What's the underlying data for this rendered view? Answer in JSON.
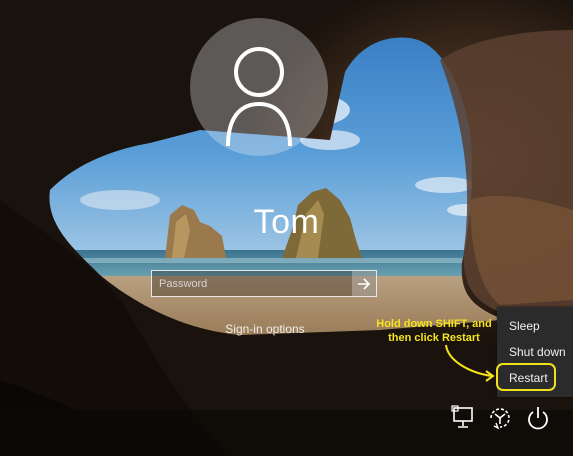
{
  "user": {
    "name": "Tom"
  },
  "password": {
    "placeholder": "Password"
  },
  "signin_options_label": "Sign-in options",
  "power_menu": {
    "items": [
      "Sleep",
      "Shut down",
      "Restart"
    ]
  },
  "annotation": {
    "text": "Hold down SHIFT, and then click Restart",
    "color": "#f5e41c"
  },
  "icons": {
    "submit": "arrow-right-icon",
    "network": "network-icon",
    "ease_of_access": "ease-of-access-icon",
    "power": "power-icon"
  }
}
